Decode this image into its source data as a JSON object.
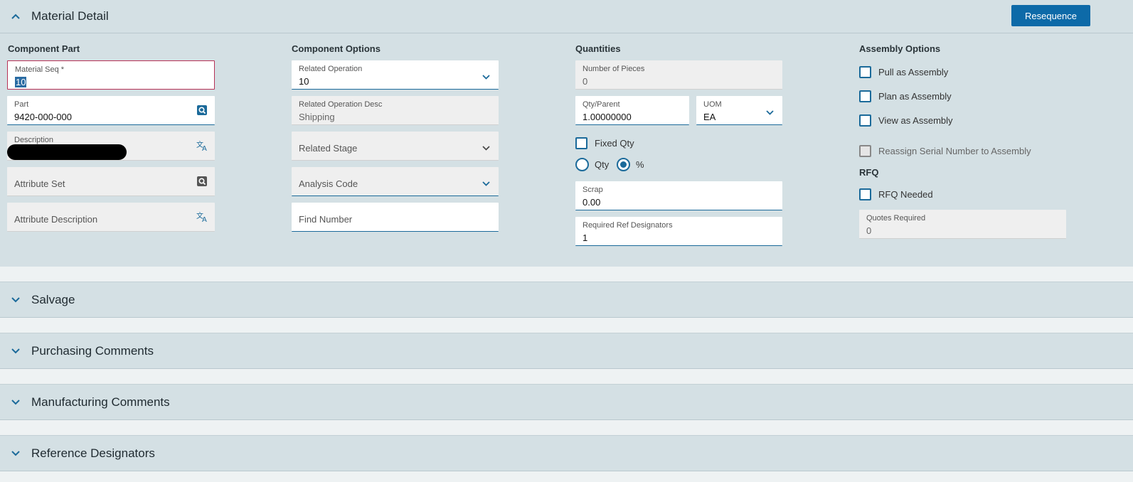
{
  "material_detail": {
    "title": "Material Detail",
    "resequence_label": "Resequence",
    "component_part": {
      "heading": "Component Part",
      "material_seq_label": "Material Seq *",
      "material_seq_value": "10",
      "part_label": "Part",
      "part_value": "9420-000-000",
      "description_label": "Description",
      "attribute_set_placeholder": "Attribute Set",
      "attribute_desc_placeholder": "Attribute Description"
    },
    "component_options": {
      "heading": "Component Options",
      "related_operation_label": "Related Operation",
      "related_operation_value": "10",
      "related_op_desc_label": "Related Operation Desc",
      "related_op_desc_value": "Shipping",
      "related_stage_placeholder": "Related Stage",
      "analysis_code_placeholder": "Analysis Code",
      "find_number_placeholder": "Find Number"
    },
    "quantities": {
      "heading": "Quantities",
      "num_pieces_label": "Number of Pieces",
      "num_pieces_value": "0",
      "qty_parent_label": "Qty/Parent",
      "qty_parent_value": "1.00000000",
      "uom_label": "UOM",
      "uom_value": "EA",
      "fixed_qty_label": "Fixed Qty",
      "radio_qty_label": "Qty",
      "radio_pct_label": "%",
      "scrap_label": "Scrap",
      "scrap_value": "0.00",
      "ref_designators_label": "Required Ref Designators",
      "ref_designators_value": "1"
    },
    "assembly_options": {
      "heading": "Assembly Options",
      "pull_as_assembly": "Pull as Assembly",
      "plan_as_assembly": "Plan as Assembly",
      "view_as_assembly": "View as Assembly",
      "reassign_serial": "Reassign Serial Number to Assembly",
      "rfq_heading": "RFQ",
      "rfq_needed": "RFQ Needed",
      "quotes_required_label": "Quotes Required",
      "quotes_required_value": "0"
    }
  },
  "sections": {
    "salvage": "Salvage",
    "purchasing_comments": "Purchasing Comments",
    "manufacturing_comments": "Manufacturing Comments",
    "reference_designators": "Reference Designators"
  },
  "colors": {
    "accent": "#1b6a9a",
    "button": "#0d6aa8",
    "panel": "#d4e0e4",
    "error_border": "#b73256"
  },
  "icons": {
    "collapse": "chevron-up-icon",
    "expand": "chevron-down-icon",
    "part_search": "search-document-icon",
    "translate": "translate-icon"
  }
}
